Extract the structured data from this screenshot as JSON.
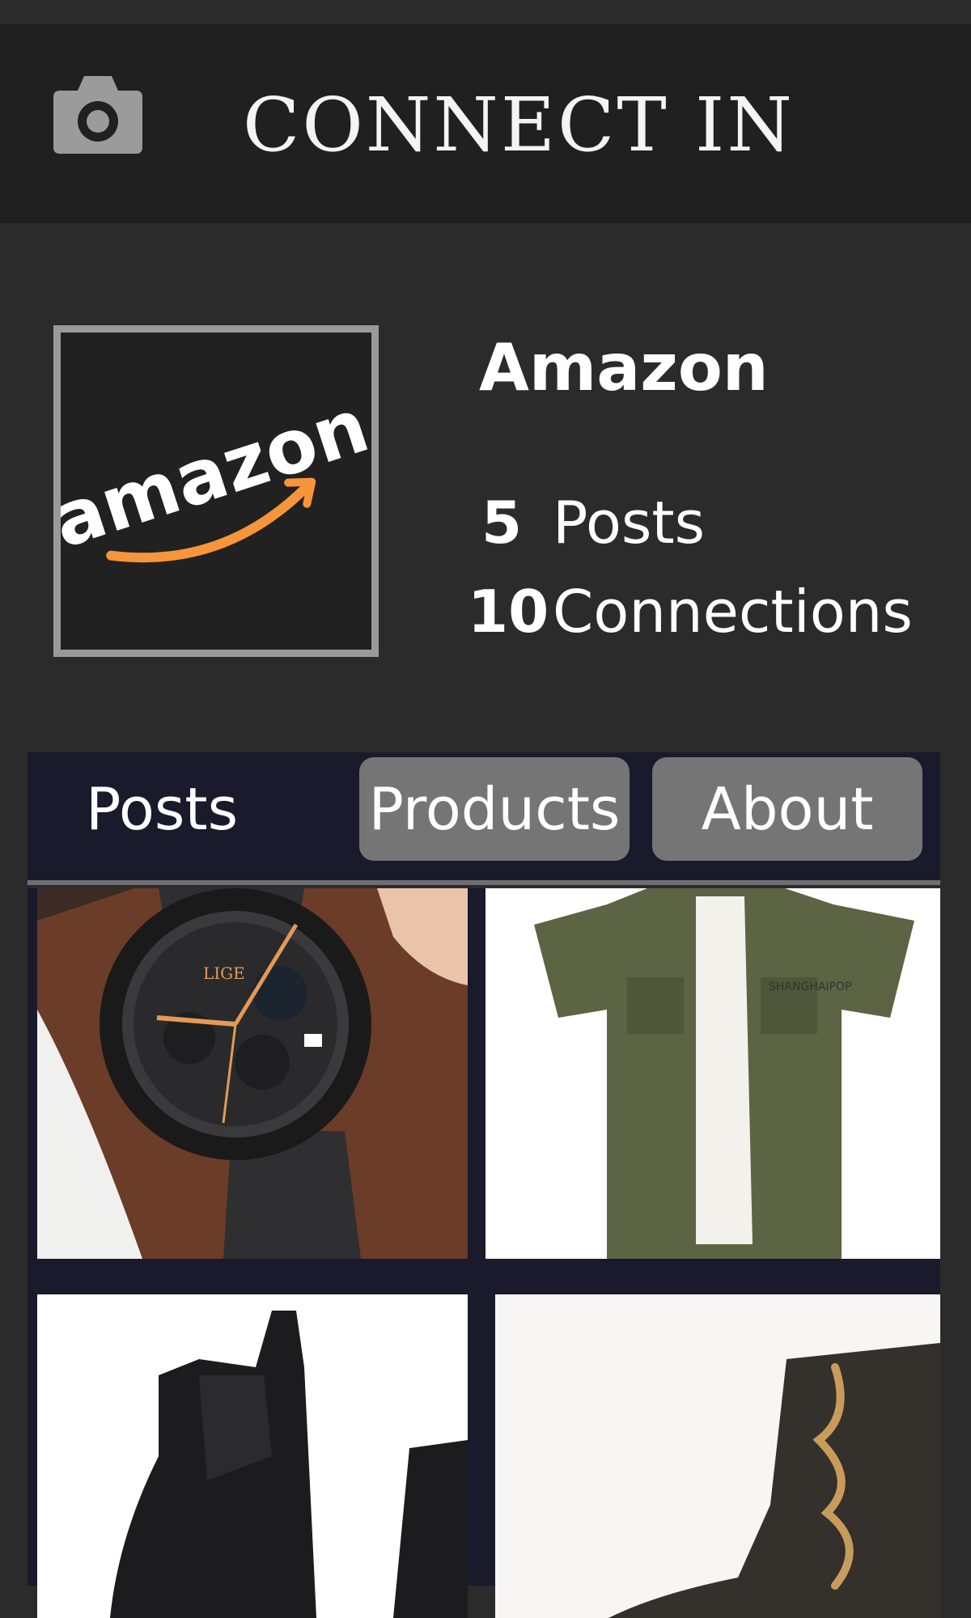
{
  "app": {
    "title": "CONNECT IN"
  },
  "header": {
    "camera_icon": "camera-icon"
  },
  "profile": {
    "name": "Amazon",
    "logo_text": "amazon",
    "logo_colors": {
      "text": "#ffffff",
      "smile": "#f7953a",
      "frame": "#9b9a9a",
      "bg": "#222122"
    },
    "stats": [
      {
        "count": "5",
        "label": "Posts"
      },
      {
        "count": "10",
        "label": "Connections"
      }
    ]
  },
  "tabs": [
    {
      "label": "Posts",
      "active": true
    },
    {
      "label": "Products",
      "active": false
    },
    {
      "label": "About",
      "active": false
    }
  ],
  "colors": {
    "background": "#2c2b2c",
    "topbar": "#212021",
    "tabbar": "#191a2b",
    "pill": "#767576"
  },
  "posts": [
    {
      "subject": "wristwatch",
      "brand_text": "LIGE"
    },
    {
      "subject": "olive-short-sleeve-shirt",
      "brand_text": "SHANGHAIPOP"
    },
    {
      "subject": "black-chelsea-boots"
    },
    {
      "subject": "lace-up-combat-boot"
    }
  ]
}
